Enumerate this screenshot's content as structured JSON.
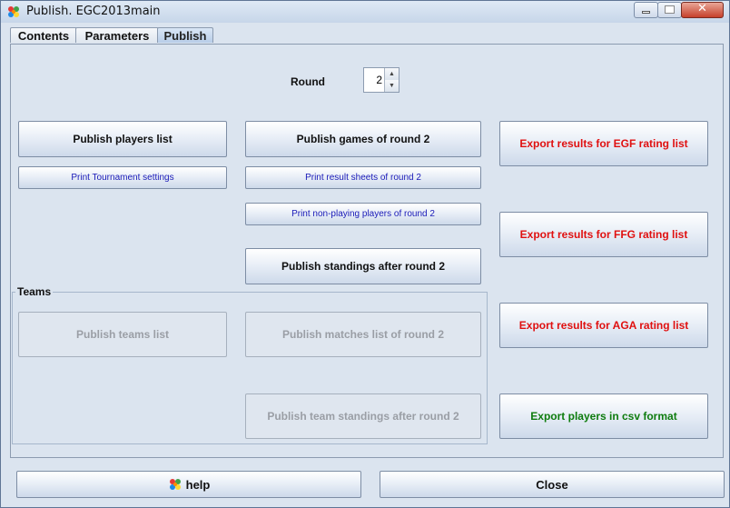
{
  "window": {
    "title": "Publish. EGC2013main",
    "close_glyph": "✕"
  },
  "tabs": [
    {
      "label": "Contents",
      "active": false
    },
    {
      "label": "Parameters",
      "active": false
    },
    {
      "label": "Publish",
      "active": true
    }
  ],
  "round": {
    "label": "Round",
    "value": "2"
  },
  "buttons": {
    "publish_players": "Publish players list",
    "print_settings": "Print Tournament settings",
    "publish_games": "Publish games of round 2",
    "print_result_sheets": "Print result sheets of round 2",
    "print_nonplaying": "Print non-playing players of round 2",
    "publish_standings": "Publish standings after round 2",
    "export_egf": "Export results for EGF rating list",
    "export_ffg": "Export results for FFG rating list",
    "export_aga": "Export results for AGA rating list",
    "export_csv": "Export players in csv format"
  },
  "teams": {
    "label": "Teams",
    "publish_teams": "Publish teams list",
    "publish_matches": "Publish matches list of round 2",
    "publish_team_standings": "Publish team standings after round 2"
  },
  "footer": {
    "help": "help",
    "close": "Close"
  },
  "colors": {
    "red_text": "#e01010",
    "green_text": "#0e7c0e",
    "link_blue": "#1a1ab8",
    "disabled": "#9a9ea5"
  },
  "icons": {
    "app": "opengotha-app-icon"
  }
}
